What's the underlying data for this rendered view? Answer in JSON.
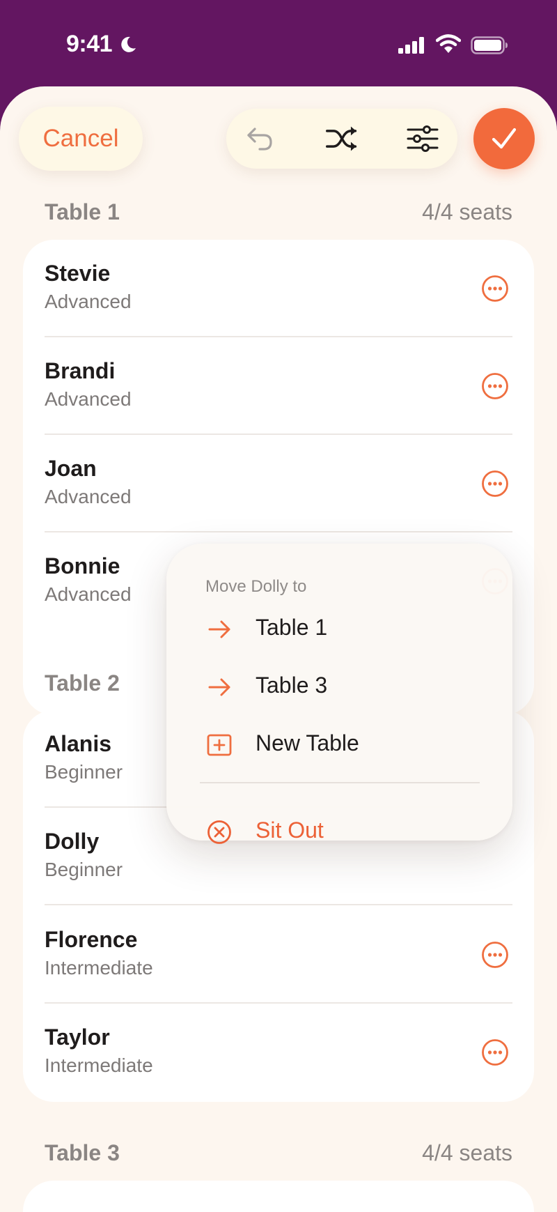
{
  "status_bar": {
    "time": "9:41"
  },
  "toolbar": {
    "cancel_label": "Cancel",
    "icons": [
      "undo-icon",
      "shuffle-icon",
      "sliders-icon",
      "checkmark-icon"
    ]
  },
  "tables": [
    {
      "title": "Table 1",
      "seats": "4/4 seats",
      "players": [
        {
          "name": "Stevie",
          "level": "Advanced"
        },
        {
          "name": "Brandi",
          "level": "Advanced"
        },
        {
          "name": "Joan",
          "level": "Advanced"
        },
        {
          "name": "Bonnie",
          "level": "Advanced"
        }
      ]
    },
    {
      "title": "Table 2",
      "players": [
        {
          "name": "Alanis",
          "level": "Beginner"
        },
        {
          "name": "Dolly",
          "level": "Beginner"
        },
        {
          "name": "Florence",
          "level": "Intermediate"
        },
        {
          "name": "Taylor",
          "level": "Intermediate"
        }
      ]
    },
    {
      "title": "Table 3",
      "seats": "4/4 seats"
    }
  ],
  "menu": {
    "title": "Move Dolly to",
    "items": [
      {
        "label": "Table 1",
        "icon": "arrow-right-icon"
      },
      {
        "label": "Table 3",
        "icon": "arrow-right-icon"
      },
      {
        "label": "New Table",
        "icon": "plus-square-icon"
      },
      {
        "label": "Sit Out",
        "icon": "x-circle-icon"
      }
    ]
  },
  "colors": {
    "brand_purple": "#631661",
    "accent_orange": "#f26a3c",
    "sheet_background": "#fdf6ef"
  }
}
